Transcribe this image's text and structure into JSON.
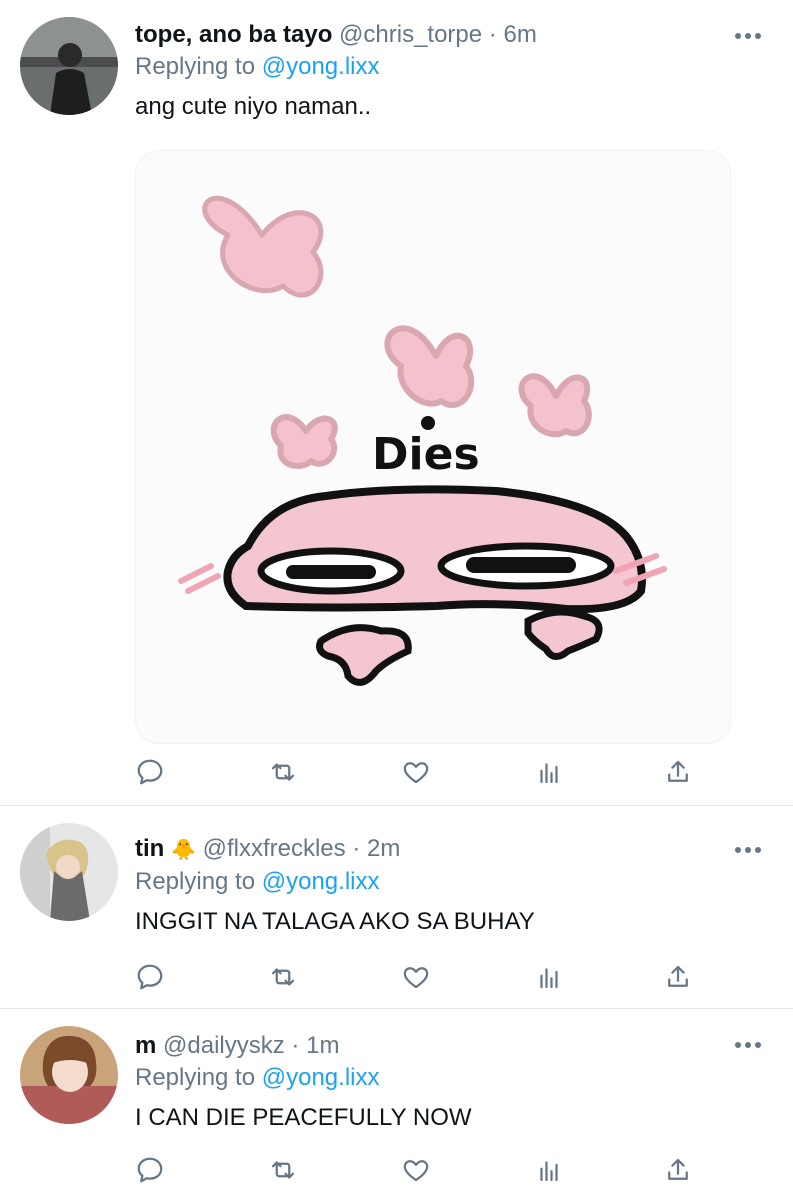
{
  "tweets": [
    {
      "name": "tope, ano ba tayo",
      "handle": "@chris_torpe",
      "separator": "·",
      "time": "6m",
      "replying_prefix": "Replying to",
      "replying_to": "@yong.lixx",
      "text": "ang cute niyo naman..",
      "media": {
        "sticker_text": "Dies"
      }
    },
    {
      "name": "tin",
      "name_emoji": "🐥",
      "handle": "@flxxfreckles",
      "separator": "·",
      "time": "2m",
      "replying_prefix": "Replying to",
      "replying_to": "@yong.lixx",
      "text": "INGGIT NA TALAGA AKO SA BUHAY"
    },
    {
      "name": "m",
      "handle": "@dailyyskz",
      "separator": "·",
      "time": "1m",
      "replying_prefix": "Replying to",
      "replying_to": "@yong.lixx",
      "text": "I CAN DIE PEACEFULLY NOW"
    }
  ],
  "icons": [
    "reply-icon",
    "retweet-icon",
    "like-icon",
    "analytics-icon",
    "share-icon",
    "more-icon"
  ],
  "colors": {
    "link": "#1da1f2",
    "secondary": "#657786",
    "divider": "#e1e8ed",
    "heart_pink": "#f0b8c4"
  }
}
